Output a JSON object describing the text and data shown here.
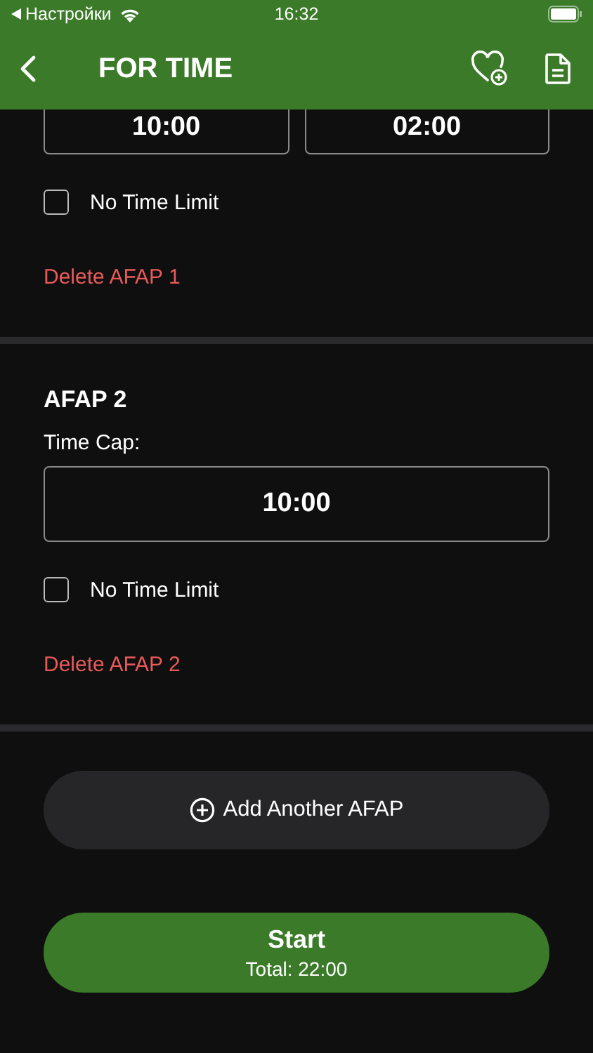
{
  "status_bar": {
    "back_label": "Настройки",
    "time": "16:32"
  },
  "nav": {
    "title": "FOR TIME"
  },
  "sections": [
    {
      "fields": [
        "10:00",
        "02:00"
      ],
      "no_time_limit": {
        "label": "No Time Limit",
        "checked": false
      },
      "delete_label": "Delete AFAP 1"
    },
    {
      "title": "AFAP 2",
      "field_label": "Time Cap:",
      "fields": [
        "10:00"
      ],
      "no_time_limit": {
        "label": "No Time Limit",
        "checked": false
      },
      "delete_label": "Delete AFAP 2"
    }
  ],
  "add_button": "Add Another AFAP",
  "start_button": {
    "label": "Start",
    "total": "Total: 22:00"
  }
}
